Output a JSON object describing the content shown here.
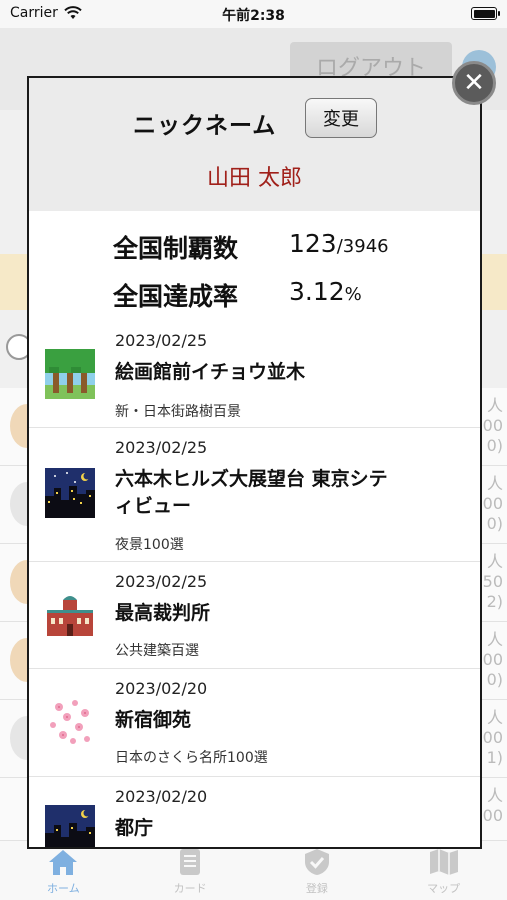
{
  "status_bar": {
    "carrier": "Carrier",
    "time": "午前2:38"
  },
  "background": {
    "logout_label": "ログアウト",
    "row_counts": [
      {
        "unit": "人",
        "a": "00",
        "b": "0)"
      },
      {
        "unit": "人",
        "a": "00",
        "b": "0)"
      },
      {
        "unit": "人",
        "a": "50",
        "b": "2)"
      },
      {
        "unit": "人",
        "a": "00",
        "b": "0)"
      },
      {
        "unit": "人",
        "a": "00",
        "b": "1)"
      },
      {
        "unit": "人",
        "a": "00",
        "b": ""
      }
    ]
  },
  "modal": {
    "nickname_label": "ニックネーム",
    "change_label": "変更",
    "nickname_value": "山田 太郎",
    "stats": {
      "conquest_label": "全国制覇数",
      "conquest_value": "123",
      "conquest_total": "/3946",
      "rate_label": "全国達成率",
      "rate_value": "3.12",
      "rate_unit": "%"
    },
    "close_icon": "close-icon",
    "visits": [
      {
        "date": "2023/02/25",
        "title": "絵画館前イチョウ並木",
        "category": "新・日本街路樹百景",
        "icon": "tree-icon"
      },
      {
        "date": "2023/02/25",
        "title": "六本木ヒルズ大展望台 東京シティビュー",
        "category": "夜景100選",
        "icon": "night-city-icon"
      },
      {
        "date": "2023/02/25",
        "title": "最高裁判所",
        "category": "公共建築百選",
        "icon": "building-icon"
      },
      {
        "date": "2023/02/20",
        "title": "新宿御苑",
        "category": "日本のさくら名所100選",
        "icon": "sakura-icon"
      },
      {
        "date": "2023/02/20",
        "title": "都庁",
        "category": "",
        "icon": "night-city-icon"
      }
    ]
  },
  "tabbar": {
    "tabs": [
      {
        "label": "ホーム",
        "icon": "home-icon",
        "active": true
      },
      {
        "label": "カード",
        "icon": "card-icon",
        "active": false
      },
      {
        "label": "登録",
        "icon": "badge-icon",
        "active": false
      },
      {
        "label": "マップ",
        "icon": "map-icon",
        "active": false
      }
    ]
  },
  "colors": {
    "accent_red": "#a0201a",
    "tab_active": "#7fb0e0"
  }
}
